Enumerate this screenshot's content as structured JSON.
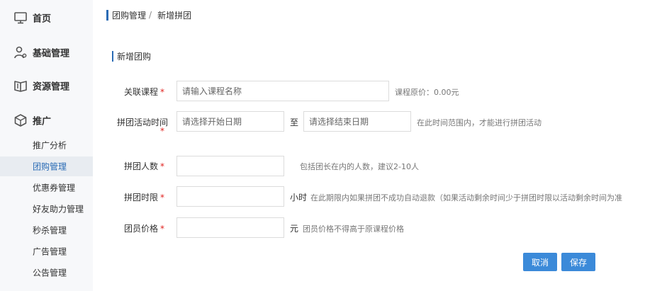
{
  "sidebar": {
    "main": [
      {
        "label": "首页",
        "icon": "monitor-icon"
      },
      {
        "label": "基础管理",
        "icon": "user-gear-icon"
      },
      {
        "label": "资源管理",
        "icon": "book-icon"
      },
      {
        "label": "推广",
        "icon": "cube-icon"
      }
    ],
    "sub": [
      {
        "label": "推广分析"
      },
      {
        "label": "团购管理"
      },
      {
        "label": "优惠券管理"
      },
      {
        "label": "好友助力管理"
      },
      {
        "label": "秒杀管理"
      },
      {
        "label": "广告管理"
      },
      {
        "label": "公告管理"
      }
    ],
    "active_sub": "团购管理"
  },
  "breadcrumb": {
    "items": [
      "团购管理",
      "新增拼团"
    ],
    "separator": "/"
  },
  "section": {
    "title": "新增团购"
  },
  "form": {
    "course": {
      "label": "关联课程",
      "required_mark": "*",
      "placeholder": "请输入课程名称",
      "value": "",
      "hint": "课程原价：0.00元"
    },
    "period": {
      "label": "拼团活动时间",
      "required_mark": "*",
      "start_placeholder": "请选择开始日期",
      "end_placeholder": "请选择结束日期",
      "connector": "至",
      "hint": "在此时间范围内，才能进行拼团活动"
    },
    "group_size": {
      "label": "拼团人数",
      "required_mark": "*",
      "value": "",
      "hint": "包括团长在内的人数，建议2-10人"
    },
    "time_limit": {
      "label": "拼团时限",
      "required_mark": "*",
      "value": "",
      "unit": "小时",
      "hint": "在此期限内如果拼团不成功自动退款（如果活动剩余时间少于拼团时限以活动剩余时间为准"
    },
    "member_price": {
      "label": "团员价格",
      "required_mark": "*",
      "value": "",
      "unit": "元",
      "hint": "团员价格不得高于原课程价格"
    }
  },
  "buttons": {
    "cancel": "取消",
    "save": "保存"
  },
  "colors": {
    "accent": "#2a6bb5",
    "button": "#3b8ad9",
    "required": "#e0221f",
    "sidebar_bg": "#f7f8fa",
    "active_bg": "#e8ecf1"
  }
}
